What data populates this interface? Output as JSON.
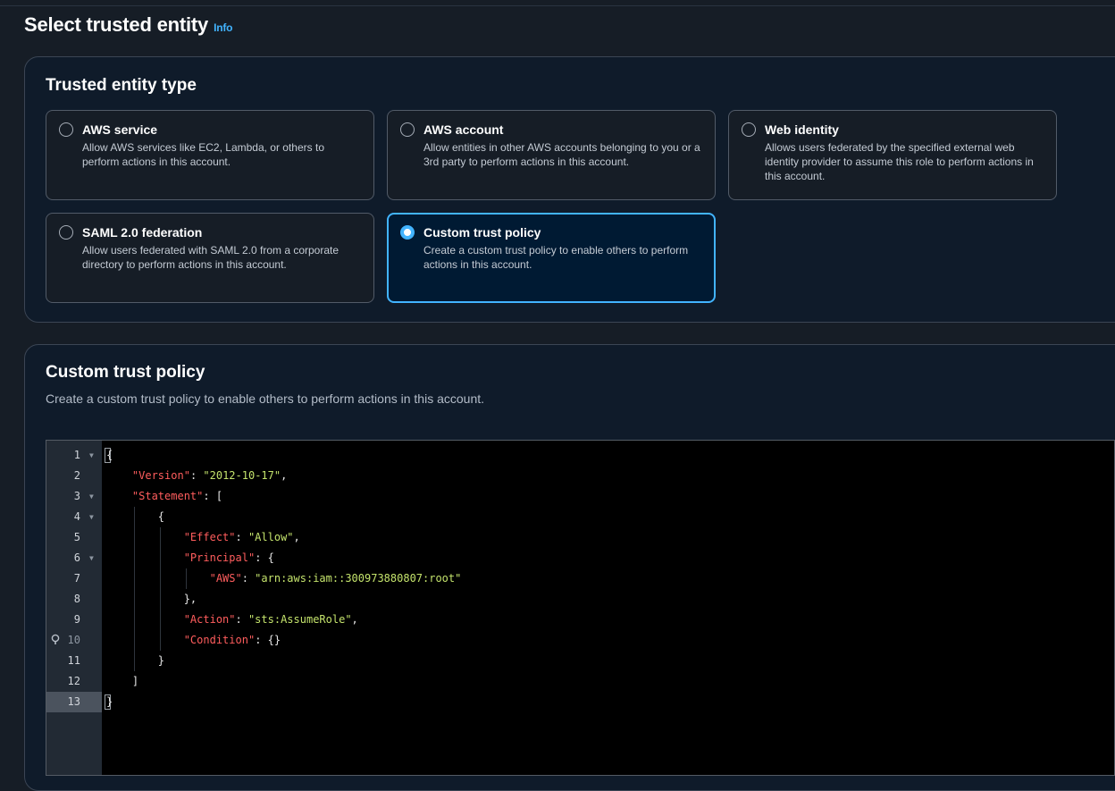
{
  "header": {
    "title": "Select trusted entity",
    "info_label": "Info"
  },
  "trusted_entity": {
    "heading": "Trusted entity type",
    "options": [
      {
        "title": "AWS service",
        "description": "Allow AWS services like EC2, Lambda, or others to perform actions in this account.",
        "selected": false
      },
      {
        "title": "AWS account",
        "description": "Allow entities in other AWS accounts belonging to you or a 3rd party to perform actions in this account.",
        "selected": false
      },
      {
        "title": "Web identity",
        "description": "Allows users federated by the specified external web identity provider to assume this role to perform actions in this account.",
        "selected": false
      },
      {
        "title": "SAML 2.0 federation",
        "description": "Allow users federated with SAML 2.0 from a corporate directory to perform actions in this account.",
        "selected": false
      },
      {
        "title": "Custom trust policy",
        "description": "Create a custom trust policy to enable others to perform actions in this account.",
        "selected": true
      }
    ]
  },
  "custom_policy": {
    "heading": "Custom trust policy",
    "description": "Create a custom trust policy to enable others to perform actions in this account.",
    "editor": {
      "line_numbers": [
        "1",
        "2",
        "3",
        "4",
        "5",
        "6",
        "7",
        "8",
        "9",
        "10",
        "11",
        "12",
        "13"
      ],
      "active_line": "13",
      "lines": [
        "{",
        "    \"Version\": \"2012-10-17\",",
        "    \"Statement\": [",
        "        {",
        "            \"Effect\": \"Allow\",",
        "            \"Principal\": {",
        "                \"AWS\": \"arn:aws:iam::300973880807:root\"",
        "            },",
        "            \"Action\": \"sts:AssumeRole\",",
        "            \"Condition\": {}",
        "        }",
        "    ]",
        "}"
      ]
    }
  },
  "colors": {
    "accent": "#42b4ff",
    "json_key": "#ff5d5d",
    "json_string": "#c4e36c",
    "background": "#161d26"
  }
}
